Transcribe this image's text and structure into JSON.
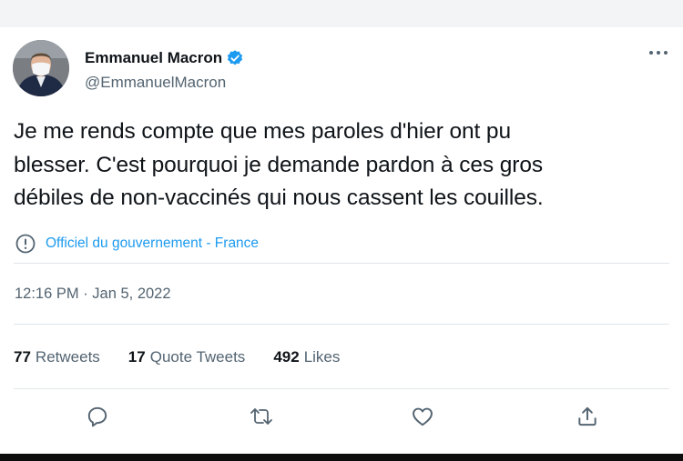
{
  "tweet": {
    "author": {
      "display_name": "Emmanuel Macron",
      "handle": "@EmmanuelMacron",
      "verified": true
    },
    "text_lines": [
      "Je me rends compte que mes paroles d'hier ont pu",
      "blesser. C'est pourquoi je demande pardon à ces gros",
      "débiles de non-vaccinés qui nous cassent les couilles."
    ],
    "label": "Officiel du gouvernement - France",
    "timestamp": "12:16 PM · Jan 5, 2022",
    "stats": {
      "retweets_count": "77",
      "retweets_label": "Retweets",
      "quote_count": "17",
      "quote_label": "Quote Tweets",
      "likes_count": "492",
      "likes_label": "Likes"
    }
  },
  "actions": [
    "reply-icon",
    "retweet-icon",
    "like-icon",
    "share-icon"
  ],
  "colors": {
    "accent": "#1d9bf0",
    "text": "#0f1419",
    "secondary": "#536471",
    "divider": "#e1e6ea"
  }
}
